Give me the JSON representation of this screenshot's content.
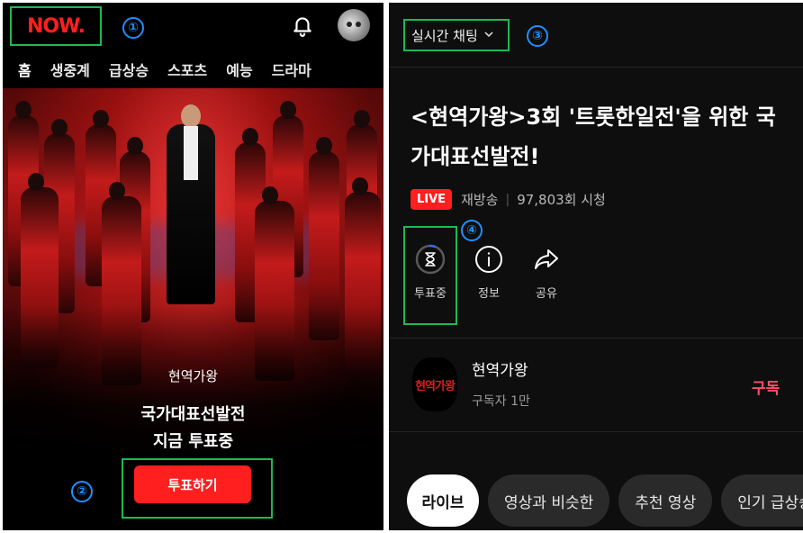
{
  "left": {
    "logo": "NOW.",
    "nav_tabs": [
      "홈",
      "생중계",
      "급상승",
      "스포츠",
      "예능",
      "드라마"
    ],
    "hero": {
      "channel": "현역가왕",
      "title_line1": "국가대표선발전",
      "title_line2": "지금 투표중",
      "vote_button": "투표하기"
    },
    "markers": {
      "one": "①",
      "two": "②"
    }
  },
  "right": {
    "chat_label": "실시간 채팅",
    "marker_three": "③",
    "marker_four": "④",
    "title": "<현역가왕>3회 '트롯한일전'을 위한 국가대표선발전!",
    "live_badge": "LIVE",
    "rebroadcast": "재방송",
    "views": "97,803회 시청",
    "actions": [
      {
        "label": "투표중",
        "icon": "hourglass-icon"
      },
      {
        "label": "정보",
        "icon": "info-icon"
      },
      {
        "label": "공유",
        "icon": "share-icon"
      }
    ],
    "channel": {
      "name": "현역가왕",
      "avatar_text": "현역가왕",
      "subscribers": "구독자 1만",
      "subscribe_label": "구독"
    },
    "chips": [
      "라이브",
      "영상과 비슷한",
      "추천 영상",
      "인기 급상승"
    ]
  },
  "colors": {
    "accent_red": "#ff1f1f",
    "highlight_green": "#1db954",
    "marker_blue": "#1e90ff",
    "subscribe_pink": "#ff4d6d"
  }
}
